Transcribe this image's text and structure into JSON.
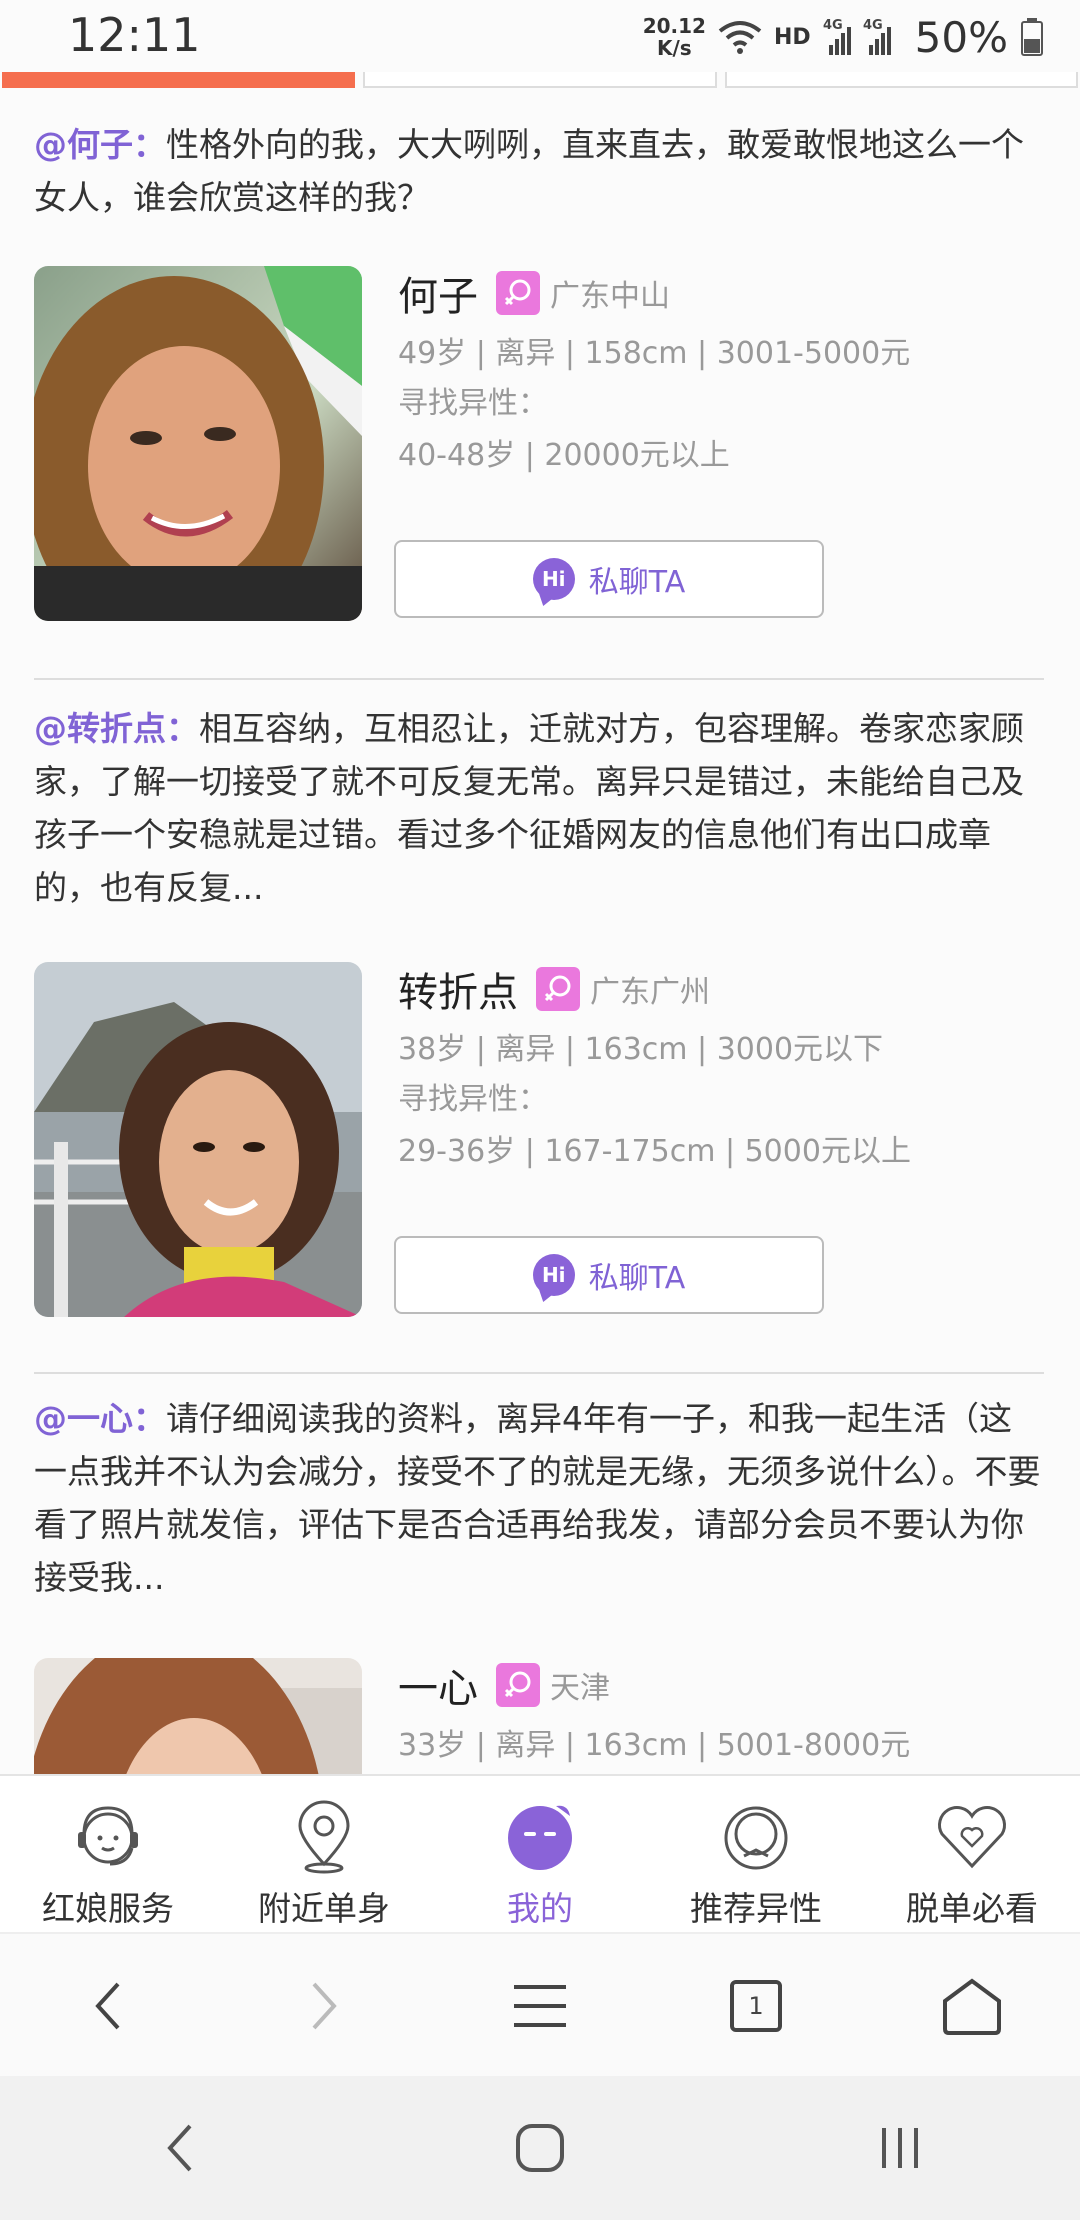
{
  "status_bar": {
    "time": "12:11",
    "net_speed_value": "20.12",
    "net_speed_unit": "K/s",
    "hd": "HD",
    "net_type": "4G",
    "battery": "50%"
  },
  "posts": [
    {
      "handle": "@何子：",
      "text": "性格外向的我，大大咧咧，直来直去，敢爱敢恨地这么一个女人，谁会欣赏这样的我？",
      "name": "何子",
      "city": "广东中山",
      "info": "49岁 | 离异 | 158cm | 3001-5000元",
      "seeking_label": "寻找异性：",
      "seeking": "40-48岁 | 20000元以上",
      "chat_label": "私聊TA"
    },
    {
      "handle": "@转折点：",
      "text": "相互容纳，互相忍让，迁就对方，包容理解。卷家恋家顾家，了解一切接受了就不可反复无常。离异只是错过，未能给自己及孩子一个安稳就是过错。看过多个征婚网友的信息他们有出口成章的，也有反复...",
      "name": "转折点",
      "city": "广东广州",
      "info": "38岁 | 离异 | 163cm | 3000元以下",
      "seeking_label": "寻找异性：",
      "seeking": "29-36岁 | 167-175cm | 5000元以上",
      "chat_label": "私聊TA"
    },
    {
      "handle": "@一心：",
      "text": "请仔细阅读我的资料，离异4年有一子，和我一起生活（这一点我并不认为会减分，接受不了的就是无缘，无须多说什么）。不要看了照片就发信，评估下是否合适再给我发，请部分会员不要认为你接受我...",
      "name": "一心",
      "city": "天津",
      "info": "33岁 | 离异 | 163cm | 5001-8000元"
    }
  ],
  "bottom_nav": [
    {
      "label": "红娘服务",
      "icon": "matchmaker-headset-icon"
    },
    {
      "label": "附近单身",
      "icon": "location-pin-icon"
    },
    {
      "label": "我的",
      "icon": "my-profile-face-icon",
      "active": true
    },
    {
      "label": "推荐异性",
      "icon": "ring-icon"
    },
    {
      "label": "脱单必看",
      "icon": "heart-icon"
    }
  ],
  "browser_bar": {
    "tab_count": "1"
  },
  "colors": {
    "accent_purple": "#8063d5",
    "active_tab_orange": "#f56e4e",
    "gender_badge_pink": "#ea78dd"
  }
}
